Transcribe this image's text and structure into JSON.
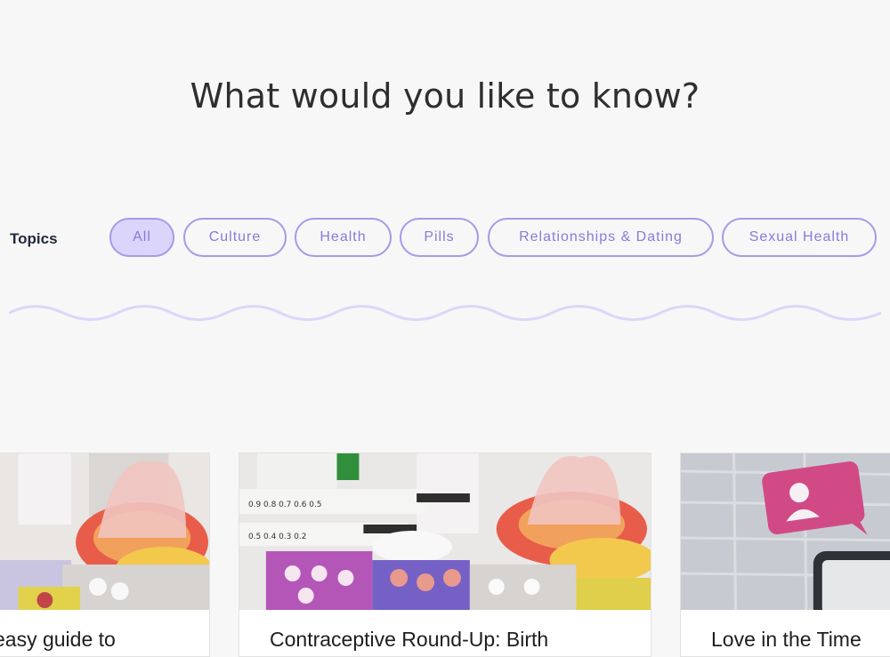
{
  "headline": "What would you like to know?",
  "topics": {
    "label": "Topics",
    "chips": [
      {
        "label": "All",
        "active": true
      },
      {
        "label": "Culture",
        "active": false
      },
      {
        "label": "Health",
        "active": false
      },
      {
        "label": "Pills",
        "active": false
      },
      {
        "label": "Relationships & Dating",
        "active": false
      },
      {
        "label": "Sexual Health",
        "active": false
      }
    ]
  },
  "colors": {
    "chip_border": "#a899e8",
    "chip_text": "#8b7ad8",
    "chip_active_bg": "#dcd5fb",
    "wave": "#ddd6fa"
  },
  "articles": [
    {
      "title": "easy guide to",
      "image": "contraceptives-photo"
    },
    {
      "title": "Contraceptive Round-Up: Birth",
      "image": "contraceptives-photo"
    },
    {
      "title": "Love in the Time",
      "image": "profile-chat-bubble-photo"
    }
  ]
}
